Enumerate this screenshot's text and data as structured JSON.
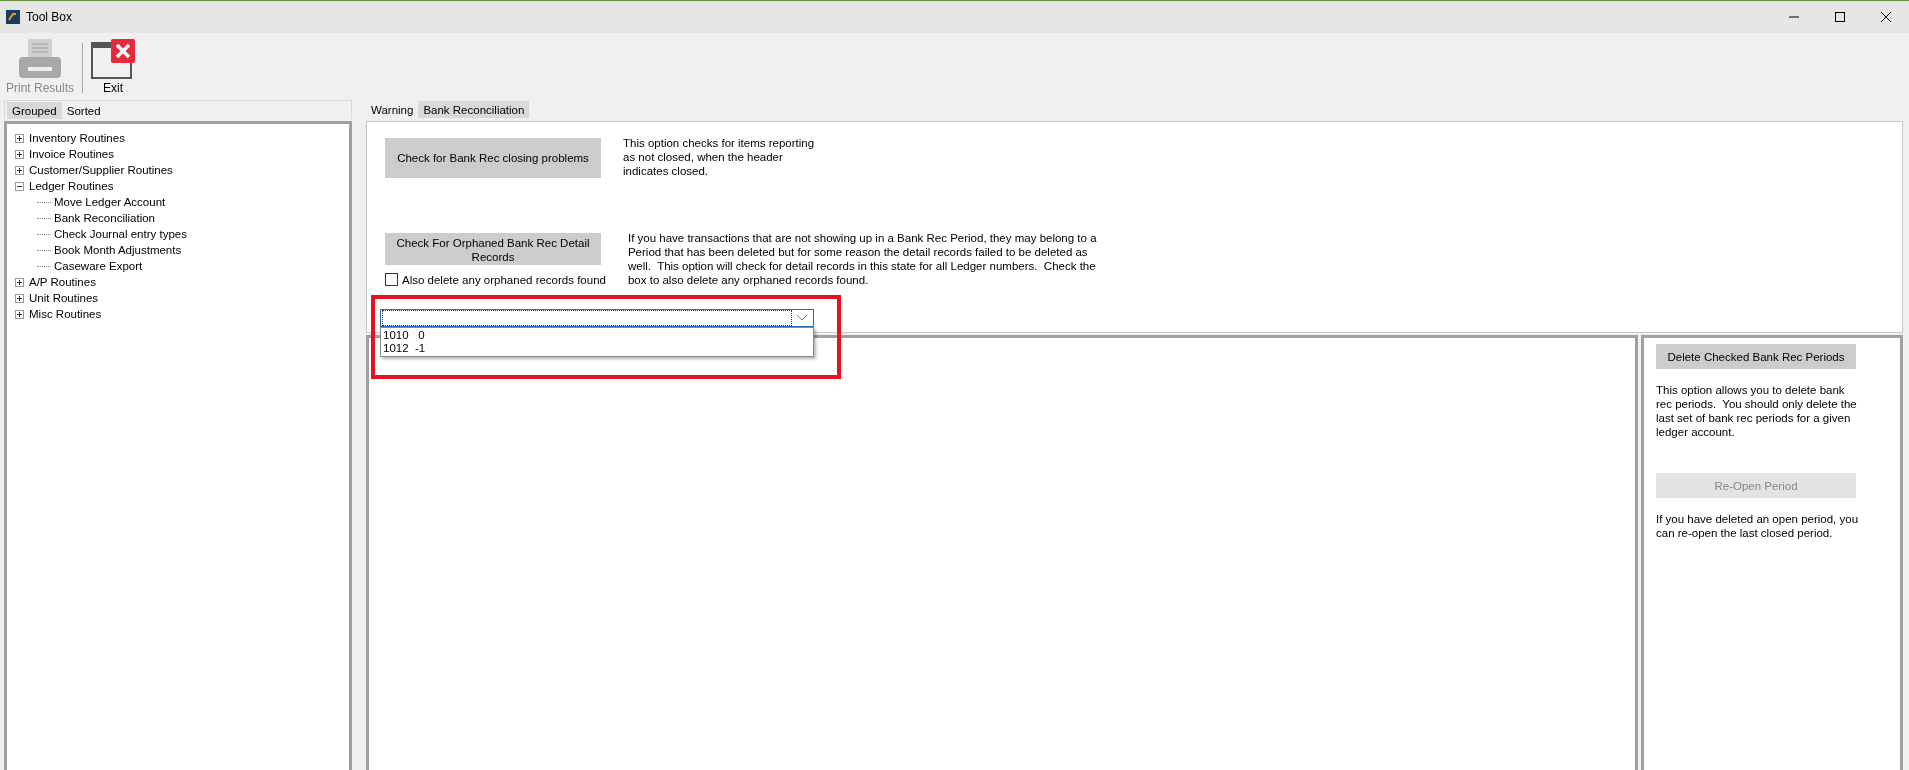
{
  "window": {
    "title": "Tool Box"
  },
  "toolbar": [
    {
      "kind": "print",
      "label": "Print Results",
      "disabled": true
    },
    {
      "kind": "exit",
      "label": "Exit",
      "disabled": false
    }
  ],
  "left_tabs": [
    {
      "label": "Grouped",
      "selected": true
    },
    {
      "label": "Sorted",
      "selected": false
    }
  ],
  "tree": [
    {
      "label": "Inventory Routines",
      "expanded": false
    },
    {
      "label": "Invoice Routines",
      "expanded": false
    },
    {
      "label": "Customer/Supplier Routines",
      "expanded": false
    },
    {
      "label": "Ledger Routines",
      "expanded": true,
      "children": [
        {
          "label": "Move Ledger Account"
        },
        {
          "label": "Bank Reconciliation"
        },
        {
          "label": "Check Journal entry types"
        },
        {
          "label": "Book Month Adjustments"
        },
        {
          "label": "Caseware Export"
        }
      ]
    },
    {
      "label": "A/P Routines",
      "expanded": false
    },
    {
      "label": "Unit Routines",
      "expanded": false
    },
    {
      "label": "Misc Routines",
      "expanded": false
    }
  ],
  "right_tabs": [
    {
      "label": "Warning",
      "selected": false
    },
    {
      "label": "Bank Reconciliation",
      "selected": true
    }
  ],
  "closing_check": {
    "button": "Check for Bank Rec closing problems",
    "description": "This option checks for items reporting as not closed, when the header indicates closed."
  },
  "orphan_check": {
    "button": "Check For Orphaned Bank Rec Detail Records",
    "checkbox": {
      "label": "Also delete any orphaned records found",
      "checked": false
    },
    "description": "If you have transactions that are not showing up in a Bank Rec Period, they may belong to a Period that has been deleted but for some reason the detail records failed to be deleted as well.  This option will check for detail records in this state for all Ledger numbers.  Check the box to also delete any orphaned records found."
  },
  "ledger_dropdown": {
    "open": true,
    "highlighted": true,
    "options": [
      "1010   0",
      "1012  -1"
    ]
  },
  "delete_periods": {
    "button": "Delete Checked Bank Rec Periods",
    "disabled": false,
    "description": "This option allows you to delete bank rec periods.  You should only delete the last set of bank rec periods for a given ledger account."
  },
  "reopen": {
    "button": "Re-Open Period",
    "disabled": true,
    "description": "If you have deleted an open period, you can re-open the last closed period."
  }
}
